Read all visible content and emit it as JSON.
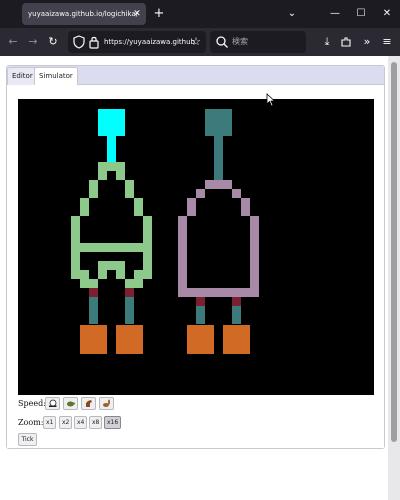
{
  "browser": {
    "tab_title": "yuyaaizawa.github.io/logichika/",
    "tab_close": "✕",
    "new_tab": "+",
    "window_buttons": {
      "list": "⌄",
      "minimize": "—",
      "maximize": "☐",
      "close": "✕"
    },
    "url": "https://yuyaaizawa.github.io/logichika/",
    "search_placeholder": "検索",
    "nav_icons": [
      "back-icon",
      "forward-icon",
      "reload-icon",
      "shield-icon",
      "lock-icon",
      "star-icon",
      "search-icon",
      "download-icon",
      "extensions-icon",
      "more-tools-icon",
      "menu-icon"
    ]
  },
  "app": {
    "tabs": [
      {
        "label": "Editor",
        "active": false
      },
      {
        "label": "Simulator",
        "active": true
      }
    ],
    "speed_label": "Speed:",
    "speed_buttons": [
      "snail-icon",
      "turtle-icon",
      "horse-icon",
      "rabbit-icon"
    ],
    "zoom_label": "Zoom:",
    "zoom_buttons": [
      {
        "label": "x1",
        "selected": false
      },
      {
        "label": "x2",
        "selected": false
      },
      {
        "label": "x4",
        "selected": false
      },
      {
        "label": "x8",
        "selected": false
      },
      {
        "label": "x16",
        "selected": true
      }
    ],
    "tick_label": "Tick"
  },
  "colors": {
    "canvas_bg": "#000000",
    "signal_on": "#00ffff",
    "signal_off": "#3b7b7b",
    "nand_gate_left": "#8dc98a",
    "nand_gate_right": "#a889a8",
    "input_wire": "#3b7b7b",
    "junction": "#7a2030",
    "input_pad": "#d06a24"
  }
}
